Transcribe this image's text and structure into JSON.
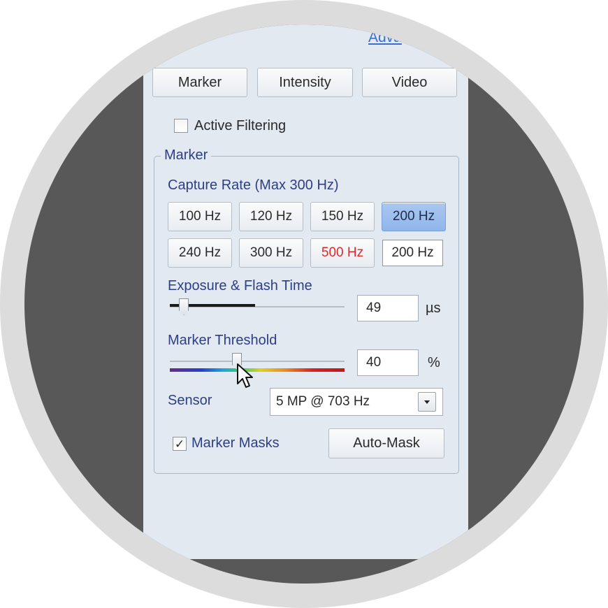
{
  "header": {
    "advanced_link": "Adva"
  },
  "tabs": [
    {
      "label": "Marker"
    },
    {
      "label": "Intensity"
    },
    {
      "label": "Video"
    }
  ],
  "active_filtering": {
    "label": "Active Filtering",
    "checked": false
  },
  "marker_group": {
    "title": "Marker",
    "capture_rate": {
      "label": "Capture Rate (Max 300 Hz)",
      "options": [
        "100 Hz",
        "120 Hz",
        "150 Hz",
        "200 Hz",
        "240 Hz",
        "300 Hz",
        "500 Hz"
      ],
      "selected": "200 Hz",
      "custom_value": "200 Hz"
    },
    "exposure": {
      "label": "Exposure & Flash Time",
      "value": "49",
      "unit": "µs",
      "slider_fraction": 0.08
    },
    "threshold": {
      "label": "Marker Threshold",
      "value": "40",
      "unit": "%",
      "slider_fraction": 0.4
    },
    "sensor": {
      "label": "Sensor",
      "selected": "5 MP @ 703 Hz"
    },
    "marker_masks": {
      "label": "Marker Masks",
      "checked": true
    },
    "auto_mask": {
      "label": "Auto-Mask"
    }
  },
  "colors": {
    "selected_rate": "#8fb6ea",
    "warning_rate": "#e02a2a",
    "link": "#3a6fd0"
  }
}
